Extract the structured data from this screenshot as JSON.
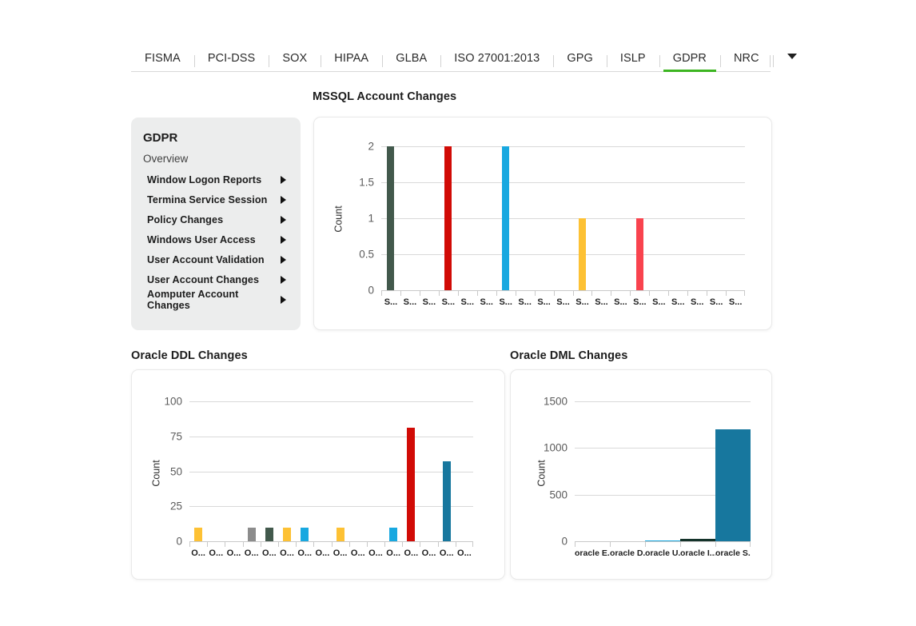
{
  "tabs": [
    {
      "label": "FISMA",
      "active": false
    },
    {
      "label": "PCI-DSS",
      "active": false
    },
    {
      "label": "SOX",
      "active": false
    },
    {
      "label": "HIPAA",
      "active": false
    },
    {
      "label": "GLBA",
      "active": false
    },
    {
      "label": "ISO 27001:2013",
      "active": false
    },
    {
      "label": "GPG",
      "active": false
    },
    {
      "label": "ISLP",
      "active": false
    },
    {
      "label": "GDPR",
      "active": true
    },
    {
      "label": "NRC",
      "active": false
    }
  ],
  "tabbar": {
    "more_icon": "chevron-down-icon",
    "active_underline_color": "#3cb521"
  },
  "sidebar": {
    "title": "GDPR",
    "overview": "Overview",
    "items": [
      {
        "label": "Window Logon Reports",
        "icon": "chevron-right-icon"
      },
      {
        "label": "Termina Service Session",
        "icon": "chevron-right-icon"
      },
      {
        "label": "Policy Changes",
        "icon": "chevron-right-icon"
      },
      {
        "label": "Windows User Access",
        "icon": "chevron-right-icon"
      },
      {
        "label": "User Account Validation",
        "icon": "chevron-right-icon"
      },
      {
        "label": "User Account Changes",
        "icon": "chevron-right-icon"
      },
      {
        "label": "Aomputer Account Changes",
        "icon": "chevron-right-icon"
      }
    ]
  },
  "chart_data": [
    {
      "id": "mssql",
      "type": "bar",
      "title": "MSSQL Account Changes",
      "xlabel": "",
      "ylabel": "Count",
      "ylim": [
        0,
        2
      ],
      "yticks": [
        0,
        0.5,
        1,
        1.5,
        2
      ],
      "ytick_labels": [
        "0",
        "0.5",
        "1",
        "1.5",
        "2"
      ],
      "grid": true,
      "legend": "none",
      "categories": [
        "S...",
        "S...",
        "S...",
        "S...",
        "S...",
        "S...",
        "S...",
        "S...",
        "S...",
        "S...",
        "S...",
        "S...",
        "S...",
        "S...",
        "S...",
        "S...",
        "S...",
        "S...",
        "S..."
      ],
      "values": [
        2,
        0,
        0,
        2,
        0,
        0,
        2,
        0,
        0,
        0,
        1,
        0,
        0,
        1,
        0,
        0,
        0,
        0,
        0
      ],
      "colors": [
        "#42594c",
        "",
        "",
        "#d10b06",
        "",
        "",
        "#18a8e0",
        "",
        "",
        "",
        "#fdc134",
        "",
        "",
        "#f9434e",
        "",
        "",
        "",
        "",
        ""
      ]
    },
    {
      "id": "ddl",
      "type": "bar",
      "title": "Oracle DDL Changes",
      "xlabel": "",
      "ylabel": "Count",
      "ylim": [
        0,
        100
      ],
      "yticks": [
        0,
        25,
        50,
        75,
        100
      ],
      "ytick_labels": [
        "0",
        "25",
        "50",
        "75",
        "100"
      ],
      "grid": true,
      "legend": "none",
      "categories": [
        "O...",
        "O...",
        "O...",
        "O...",
        "O...",
        "O...",
        "O...",
        "O...",
        "O...",
        "O...",
        "O...",
        "O...",
        "O...",
        "O...",
        "O...",
        "O..."
      ],
      "values": [
        10,
        0,
        0,
        10,
        10,
        10,
        10,
        0,
        10,
        0,
        0,
        10,
        81,
        0,
        57,
        0
      ],
      "colors": [
        "#fdc134",
        "",
        "",
        "#8c8c8c",
        "#42594c",
        "#fdc134",
        "#18a8e0",
        "",
        "#fdc134",
        "",
        "",
        "#18a8e0",
        "#d10b06",
        "",
        "#17779e",
        ""
      ]
    },
    {
      "id": "dml",
      "type": "bar",
      "title": "Oracle DML Changes",
      "xlabel": "",
      "ylabel": "Count",
      "ylim": [
        0,
        1500
      ],
      "yticks": [
        0,
        500,
        1000,
        1500
      ],
      "ytick_labels": [
        "0",
        "500",
        "1000",
        "1500"
      ],
      "grid": true,
      "legend": "none",
      "categories": [
        "oracle E...",
        "oracle D...",
        "oracle U...",
        "oracle I...",
        "oracle S..."
      ],
      "values": [
        0,
        0,
        10,
        25,
        1200
      ],
      "colors": [
        "#fdc134",
        "#d10b06",
        "#18a8e0",
        "#14332a",
        "#17779e"
      ]
    }
  ]
}
